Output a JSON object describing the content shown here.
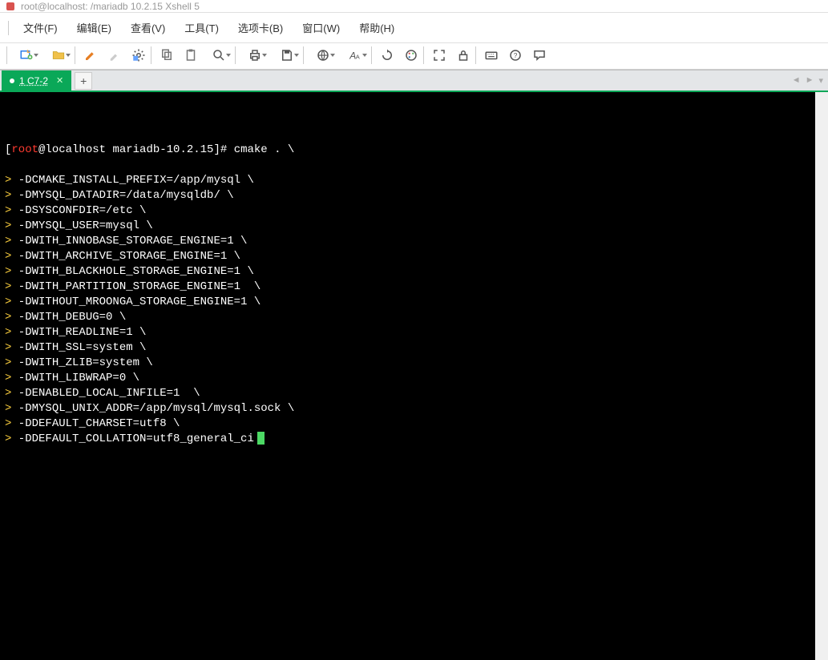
{
  "window": {
    "title_fragment": "root@localhost: /mariadb 10.2.15   Xshell 5"
  },
  "menu": {
    "items": [
      "文件(F)",
      "编辑(E)",
      "查看(V)",
      "工具(T)",
      "选项卡(B)",
      "窗口(W)",
      "帮助(H)"
    ]
  },
  "toolbar": {
    "icons": [
      "new-session",
      "open",
      "divider",
      "edit",
      "properties",
      "highlight",
      "settings",
      "divider",
      "copy",
      "paste",
      "search",
      "divider",
      "print",
      "save",
      "divider",
      "globe",
      "font",
      "divider",
      "refresh",
      "color",
      "divider",
      "fullscreen",
      "lock",
      "divider",
      "keyboard",
      "help",
      "chat"
    ]
  },
  "tabs": {
    "items": [
      {
        "label": "1 C7-2",
        "active": true
      }
    ],
    "add_label": "+"
  },
  "terminal": {
    "prompt_user": "root",
    "prompt_host": "localhost",
    "prompt_path": "mariadb-10.2.15",
    "prompt_symbol": "#",
    "command": "cmake . \\",
    "lines": [
      "-DCMAKE_INSTALL_PREFIX=/app/mysql \\",
      "-DMYSQL_DATADIR=/data/mysqldb/ \\",
      "-DSYSCONFDIR=/etc \\",
      "-DMYSQL_USER=mysql \\",
      "-DWITH_INNOBASE_STORAGE_ENGINE=1 \\",
      "-DWITH_ARCHIVE_STORAGE_ENGINE=1 \\",
      "-DWITH_BLACKHOLE_STORAGE_ENGINE=1 \\",
      "-DWITH_PARTITION_STORAGE_ENGINE=1  \\",
      "-DWITHOUT_MROONGA_STORAGE_ENGINE=1 \\",
      "-DWITH_DEBUG=0 \\",
      "-DWITH_READLINE=1 \\",
      "-DWITH_SSL=system \\",
      "-DWITH_ZLIB=system \\",
      "-DWITH_LIBWRAP=0 \\",
      "-DENABLED_LOCAL_INFILE=1  \\",
      "-DMYSQL_UNIX_ADDR=/app/mysql/mysql.sock \\",
      "-DDEFAULT_CHARSET=utf8 \\",
      "-DDEFAULT_COLLATION=utf8_general_ci"
    ],
    "continuation": ">"
  }
}
